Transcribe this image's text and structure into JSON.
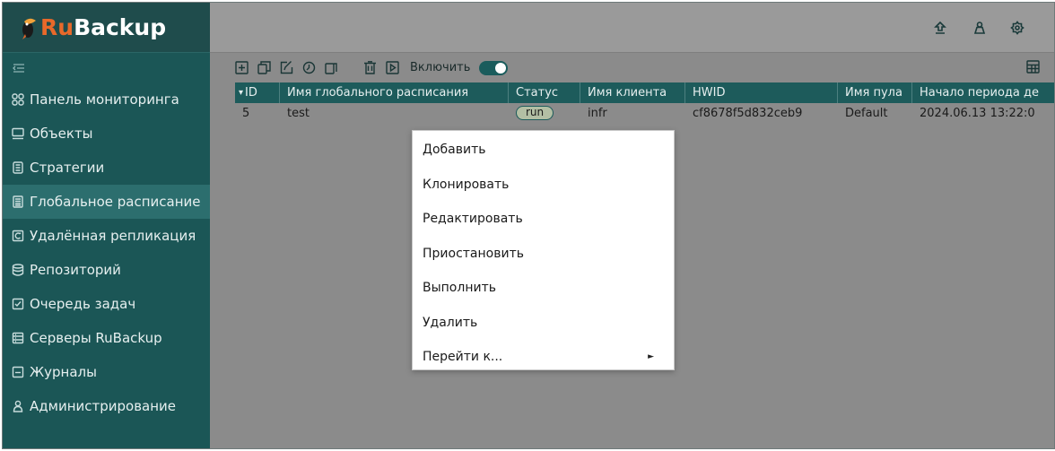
{
  "app": {
    "logo_ru": "Ru",
    "logo_backup": "Backup"
  },
  "sidebar": {
    "items": [
      {
        "label": "Панель мониторинга",
        "icon": "grid-icon"
      },
      {
        "label": "Объекты",
        "icon": "monitor-icon"
      },
      {
        "label": "Стратегии",
        "icon": "document-icon"
      },
      {
        "label": "Глобальное расписание",
        "icon": "schedule-icon"
      },
      {
        "label": "Удалённая репликация",
        "icon": "replication-icon"
      },
      {
        "label": "Репозиторий",
        "icon": "database-icon"
      },
      {
        "label": "Очередь задач",
        "icon": "queue-icon"
      },
      {
        "label": "Серверы RuBackup",
        "icon": "server-icon"
      },
      {
        "label": "Журналы",
        "icon": "log-icon"
      },
      {
        "label": "Администрирование",
        "icon": "admin-icon"
      }
    ],
    "active_index": 3
  },
  "toolbar": {
    "toggle_label": "Включить",
    "toggle_on": true
  },
  "table": {
    "columns": [
      "ID",
      "Имя глобального расписания",
      "Статус",
      "Имя клиента",
      "HWID",
      "Имя пула",
      "Начало периода де"
    ],
    "sort_indicator": "▾",
    "rows": [
      {
        "id": "5",
        "name": "test",
        "status": "run",
        "client": "infr",
        "hwid": "cf8678f5d832ceb9",
        "pool": "Default",
        "start": "2024.06.13 13:22:0"
      }
    ]
  },
  "context_menu": {
    "items": [
      {
        "label": "Добавить"
      },
      {
        "label": "Клонировать"
      },
      {
        "label": "Редактировать"
      },
      {
        "label": "Приостановить"
      },
      {
        "label": "Выполнить"
      },
      {
        "label": "Удалить"
      },
      {
        "label": "Перейти к...",
        "submenu_arrow": "►"
      }
    ]
  },
  "colors": {
    "sidebar_bg": "#1b5656",
    "header_bg": "#1d5b5b",
    "logo_accent": "#e8692a",
    "overlay_gray": "#8b8b8b"
  }
}
